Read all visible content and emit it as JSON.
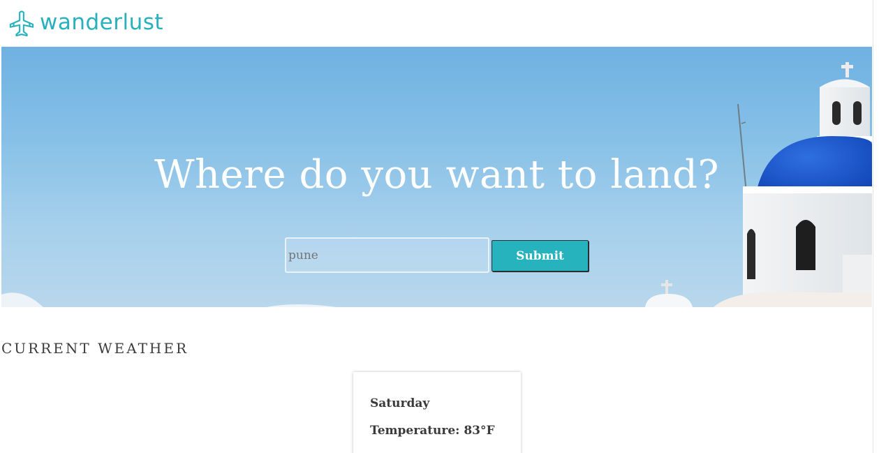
{
  "header": {
    "brand": "wanderlust",
    "logo_icon": "airplane-icon",
    "accent_color": "#26b1bd"
  },
  "hero": {
    "title": "Where do you want to land?",
    "search": {
      "value": "",
      "placeholder": "pune"
    },
    "submit_label": "Submit",
    "button_color": "#26b3bd"
  },
  "weather": {
    "heading": "CURRENT WEATHER",
    "day": "Saturday",
    "temperature_text": "Temperature: 83°F"
  }
}
